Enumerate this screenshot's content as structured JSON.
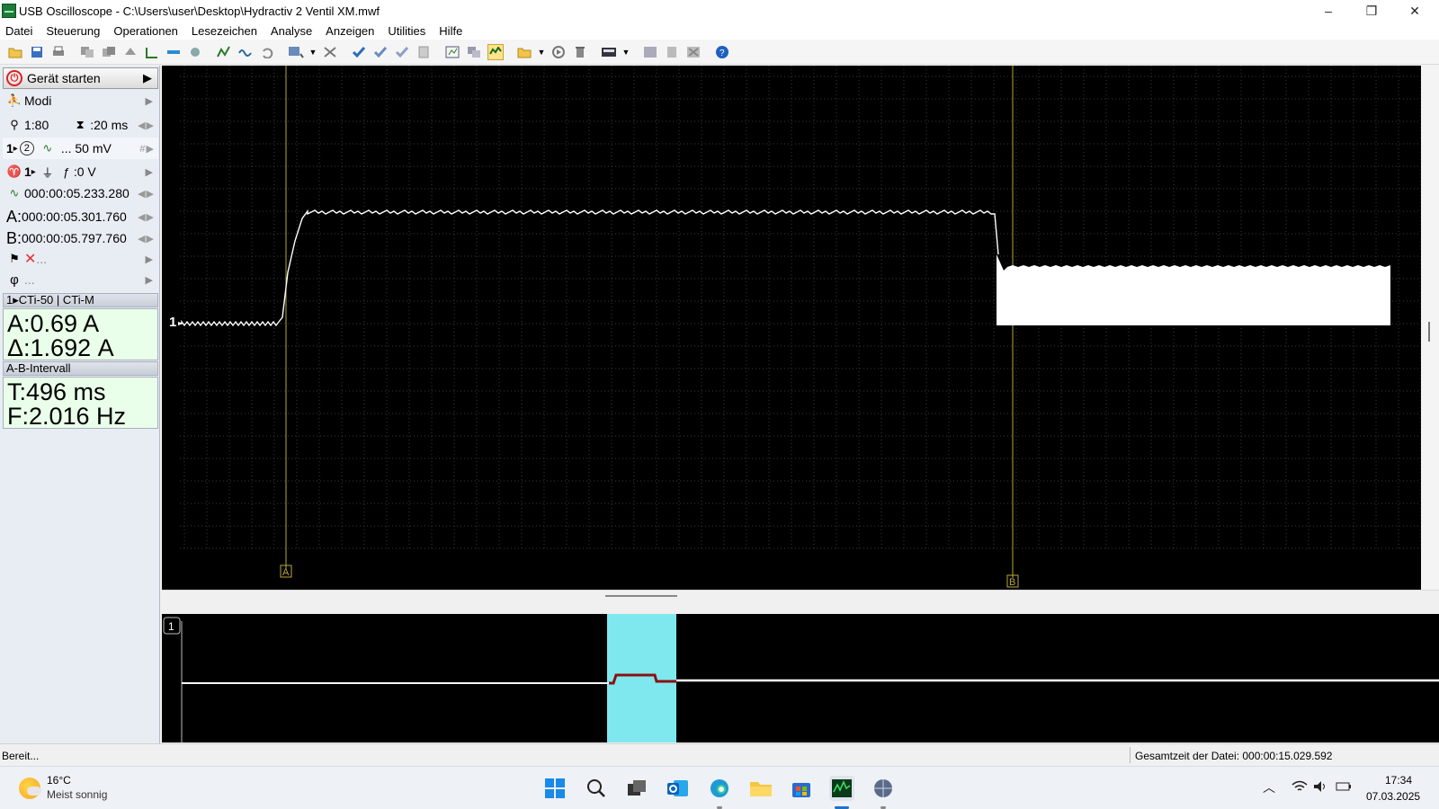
{
  "window": {
    "title": "USB Oscilloscope - C:\\Users\\user\\Desktop\\Hydractiv 2 Ventil XM.mwf",
    "minimize": "–",
    "maximize": "❐",
    "close": "✕"
  },
  "menu": [
    "Datei",
    "Steuerung",
    "Operationen",
    "Lesezeichen",
    "Analyse",
    "Anzeigen",
    "Utilities",
    "Hilfe"
  ],
  "left_panel": {
    "start_label": "Gerät starten",
    "modes_label": "Modi",
    "zoom": "1:80",
    "timebase": ":20 ms",
    "channel_prefix": "1",
    "channel_num": "2",
    "channel_scale": "... 50 mV",
    "trigger_prefix": "1",
    "trigger_level": ":0 V",
    "trigger_time": "000:00:05.233.280",
    "cursor_a_label": "A:",
    "cursor_a_time": "000:00:05.301.760",
    "cursor_b_label": "B:",
    "cursor_b_time": "000:00:05.797.760",
    "filter_label": "...",
    "phase_label": "...",
    "probe_header": "1▸CTi-50 | CTi-M",
    "meas_a": "A:0.69 A",
    "meas_delta": "Δ:1.692 A",
    "interval_header": "A-B-Intervall",
    "interval_t": "T:496 ms",
    "interval_f": "F:2.016 Hz"
  },
  "scope": {
    "channel_marker": "1",
    "cursor_a_tag": "A",
    "cursor_b_tag": "B",
    "trace_color": "#ffffff",
    "grid_color": "#3a3a3a",
    "cursor_color": "#b8a838"
  },
  "overview": {
    "channel_tag": "1",
    "highlight_color": "#7fe8ef"
  },
  "status": {
    "left": "Bereit...",
    "right": "Gesamtzeit der Datei: 000:00:15.029.592"
  },
  "taskbar": {
    "temperature": "16°C",
    "weather": "Meist sonnig",
    "time": "17:34",
    "date": "07.03.2025"
  }
}
